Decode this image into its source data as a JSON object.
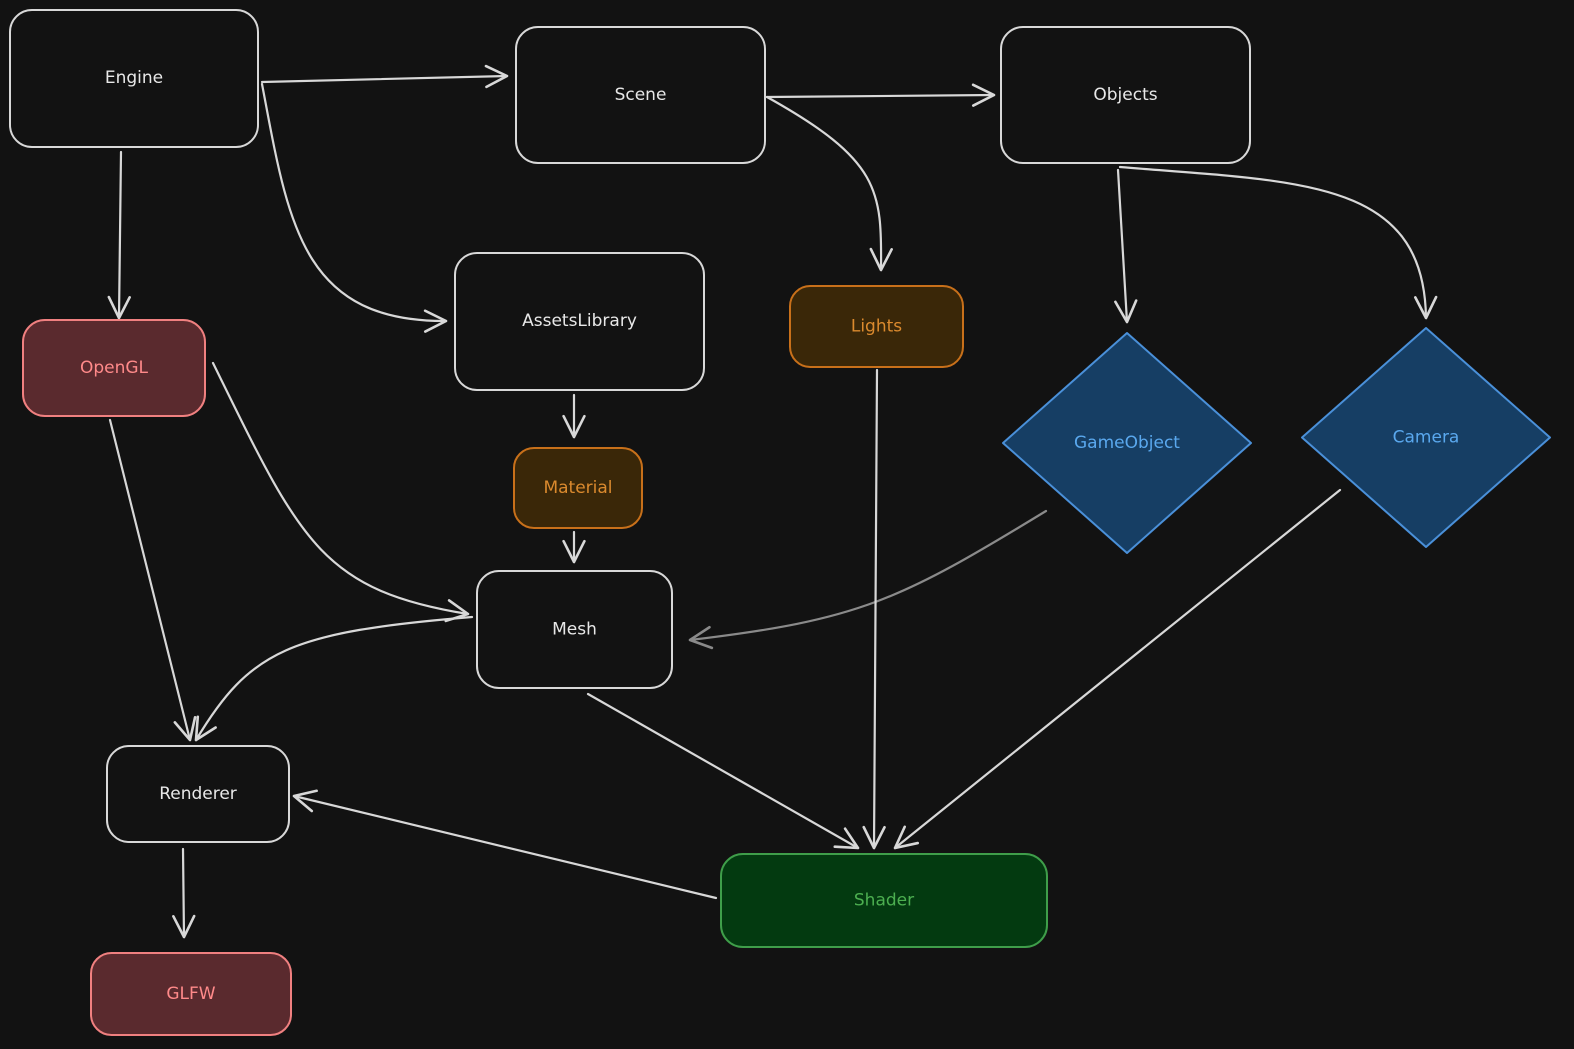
{
  "colors": {
    "background": "#121212",
    "default_stroke": "#d8d8d8",
    "default_text": "#e8e8e8",
    "muted_edge": "#8a8a8a"
  },
  "styles": {
    "plain": {
      "fill": "#121212",
      "stroke": "#d8d8d8",
      "text": "#e8e8e8"
    },
    "red": {
      "fill": "#5a2a2e",
      "stroke": "#f08080",
      "text": "#ff8a8a"
    },
    "orange": {
      "fill": "#3a2708",
      "stroke": "#c8701a",
      "text": "#db8a2e"
    },
    "blue": {
      "fill": "#163e64",
      "stroke": "#4a90d9",
      "text": "#5aa8ee"
    },
    "green": {
      "fill": "#033a10",
      "stroke": "#3f9e4a",
      "text": "#4caf50"
    }
  },
  "nodes": [
    {
      "id": "engine",
      "label": "Engine",
      "shape": "rounded-rect",
      "style": "plain"
    },
    {
      "id": "scene",
      "label": "Scene",
      "shape": "rounded-rect",
      "style": "plain"
    },
    {
      "id": "objects",
      "label": "Objects",
      "shape": "rounded-rect",
      "style": "plain"
    },
    {
      "id": "assets",
      "label": "AssetsLibrary",
      "shape": "rounded-rect",
      "style": "plain"
    },
    {
      "id": "lights",
      "label": "Lights",
      "shape": "rounded-rect",
      "style": "orange"
    },
    {
      "id": "opengl",
      "label": "OpenGL",
      "shape": "rounded-rect",
      "style": "red"
    },
    {
      "id": "material",
      "label": "Material",
      "shape": "rounded-rect",
      "style": "orange"
    },
    {
      "id": "gameobject",
      "label": "GameObject",
      "shape": "diamond",
      "style": "blue"
    },
    {
      "id": "camera",
      "label": "Camera",
      "shape": "diamond",
      "style": "blue"
    },
    {
      "id": "mesh",
      "label": "Mesh",
      "shape": "rounded-rect",
      "style": "plain"
    },
    {
      "id": "renderer",
      "label": "Renderer",
      "shape": "rounded-rect",
      "style": "plain"
    },
    {
      "id": "shader",
      "label": "Shader",
      "shape": "rounded-rect",
      "style": "green"
    },
    {
      "id": "glfw",
      "label": "GLFW",
      "shape": "rounded-rect",
      "style": "red"
    }
  ],
  "edges": [
    {
      "from": "engine",
      "to": "scene"
    },
    {
      "from": "scene",
      "to": "objects"
    },
    {
      "from": "engine",
      "to": "opengl"
    },
    {
      "from": "engine",
      "to": "assets"
    },
    {
      "from": "scene",
      "to": "lights"
    },
    {
      "from": "objects",
      "to": "gameobject"
    },
    {
      "from": "objects",
      "to": "camera"
    },
    {
      "from": "assets",
      "to": "material"
    },
    {
      "from": "material",
      "to": "mesh"
    },
    {
      "from": "opengl",
      "to": "mesh"
    },
    {
      "from": "opengl",
      "to": "renderer"
    },
    {
      "from": "mesh",
      "to": "renderer"
    },
    {
      "from": "gameobject",
      "to": "mesh",
      "muted": true
    },
    {
      "from": "lights",
      "to": "shader"
    },
    {
      "from": "mesh",
      "to": "shader"
    },
    {
      "from": "camera",
      "to": "shader"
    },
    {
      "from": "shader",
      "to": "renderer"
    },
    {
      "from": "renderer",
      "to": "glfw"
    }
  ]
}
